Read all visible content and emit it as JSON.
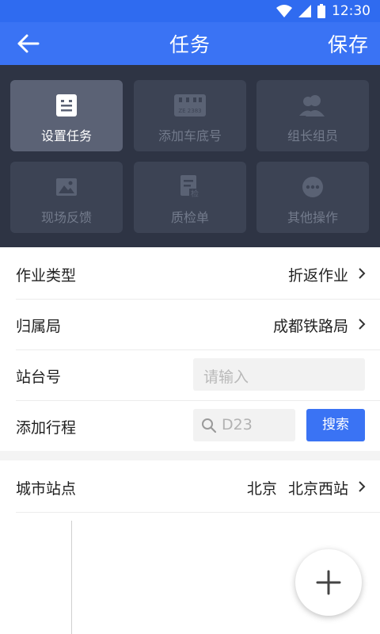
{
  "status_bar": {
    "time": "12:30",
    "icons": [
      "wifi-icon",
      "cell-signal-icon",
      "battery-icon"
    ]
  },
  "header": {
    "title": "任务",
    "save_label": "保存",
    "back_icon": "arrow-left-icon"
  },
  "menu_tiles": [
    {
      "label": "设置任务",
      "icon": "list-icon",
      "active": true
    },
    {
      "label": "添加车底号",
      "icon": "license-plate-icon",
      "plate_text": "ZE 2383",
      "active": false
    },
    {
      "label": "组长组员",
      "icon": "users-icon",
      "active": false
    },
    {
      "label": "现场反馈",
      "icon": "image-icon",
      "active": false
    },
    {
      "label": "质检单",
      "icon": "inspection-doc-icon",
      "badge_text": "检",
      "active": false
    },
    {
      "label": "其他操作",
      "icon": "more-icon",
      "active": false
    }
  ],
  "form": {
    "work_type": {
      "label": "作业类型",
      "value": "折返作业"
    },
    "bureau": {
      "label": "归属局",
      "value": "成都铁路局"
    },
    "platform": {
      "label": "站台号",
      "placeholder": "请输入"
    },
    "trip": {
      "label": "添加行程",
      "placeholder": "D23",
      "search_label": "搜索"
    }
  },
  "city_station": {
    "label": "城市站点",
    "city": "北京",
    "station": "北京西站"
  },
  "fab": {
    "icon": "plus-icon"
  },
  "colors": {
    "primary": "#3a73f4",
    "status_bar": "#2f6bf0",
    "panel": "#2e3444",
    "tile": "#3c4354",
    "tile_active": "#5b6275"
  }
}
